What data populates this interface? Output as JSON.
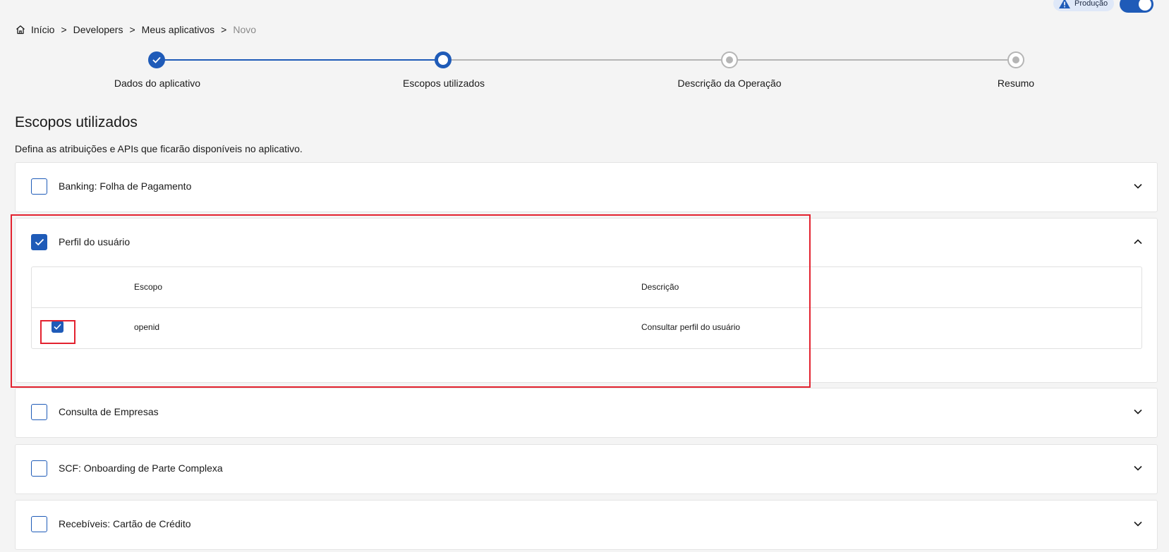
{
  "environment": {
    "badge_label": "Produção",
    "toggle_on": true,
    "accent": "#1f5bb8"
  },
  "breadcrumb": {
    "items": [
      "Início",
      "Developers",
      "Meus aplicativos"
    ],
    "current": "Novo",
    "separator": ">"
  },
  "stepper": {
    "steps": [
      {
        "label": "Dados do aplicativo",
        "state": "done"
      },
      {
        "label": "Escopos utilizados",
        "state": "active"
      },
      {
        "label": "Descrição da Operação",
        "state": "todo"
      },
      {
        "label": "Resumo",
        "state": "todo"
      }
    ]
  },
  "page": {
    "title": "Escopos utilizados",
    "subtitle": "Defina as atribuições e APIs que ficarão disponíveis no aplicativo."
  },
  "scopes": [
    {
      "title": "Banking: Folha de Pagamento",
      "checked": false,
      "expanded": false
    },
    {
      "title": "Perfil do usuário",
      "checked": true,
      "expanded": true,
      "table": {
        "headers": [
          "Escopo",
          "Descrição"
        ],
        "rows": [
          {
            "checked": true,
            "scope": "openid",
            "description": "Consultar perfil do usuário"
          }
        ]
      }
    },
    {
      "title": "Consulta de Empresas",
      "checked": false,
      "expanded": false
    },
    {
      "title": "SCF: Onboarding de Parte Complexa",
      "checked": false,
      "expanded": false
    },
    {
      "title": "Recebíveis: Cartão de Crédito",
      "checked": false,
      "expanded": false
    }
  ],
  "icons": {
    "home": "home-icon",
    "warning": "warning-icon",
    "check": "check-icon",
    "chevron_down": "chevron-down-icon",
    "chevron_up": "chevron-up-icon"
  },
  "colors": {
    "primary": "#1f5bb8",
    "highlight": "#e3222f",
    "inactive_step": "#b5b5b5"
  }
}
